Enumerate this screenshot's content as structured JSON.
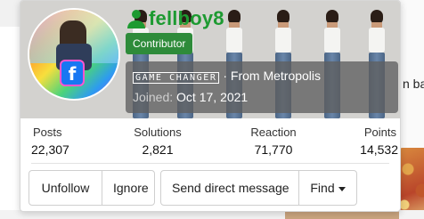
{
  "background": {
    "snippet_text": "n ba"
  },
  "profile": {
    "username": "fellboy8",
    "badge": "Contributor",
    "custom_title": "GAME CHANGER",
    "location_prefix": "· From ",
    "location": "Metropolis",
    "joined_label": "Joined:",
    "joined_date": "Oct 17, 2021",
    "accent_color": "#1d9a31",
    "badge_color": "#2e8b3a"
  },
  "stats": [
    {
      "label": "Posts",
      "value": "22,307"
    },
    {
      "label": "Solutions",
      "value": "2,821"
    },
    {
      "label": "Reaction",
      "value": "71,770"
    },
    {
      "label": "Points",
      "value": "14,532"
    }
  ],
  "actions": {
    "unfollow": "Unfollow",
    "ignore": "Ignore",
    "send_message": "Send direct message",
    "find": "Find"
  },
  "icons": {
    "user": "user-icon",
    "find_dropdown": "chevron-down-icon",
    "avatar_logo": "facebook-logo"
  }
}
